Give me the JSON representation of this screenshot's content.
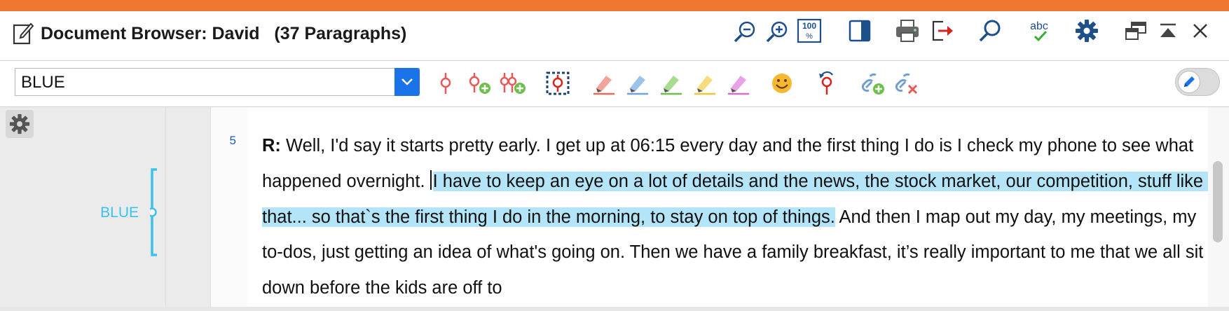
{
  "window": {
    "accent_color": "#f0782e",
    "title": "Document Browser: David   (37 Paragraphs)"
  },
  "title_icons": [
    {
      "name": "zoom-out-icon"
    },
    {
      "name": "zoom-in-icon"
    },
    {
      "name": "zoom-100-icon",
      "text": "100"
    },
    {
      "name": "panel-toggle-icon"
    },
    {
      "name": "print-icon"
    },
    {
      "name": "export-icon"
    },
    {
      "name": "search-icon"
    },
    {
      "name": "spellcheck-icon",
      "text": "abc"
    },
    {
      "name": "settings-gear-icon"
    },
    {
      "name": "undock-window-icon"
    },
    {
      "name": "collapse-icon"
    },
    {
      "name": "close-icon"
    }
  ],
  "toolbar": {
    "code_selector_value": "BLUE",
    "tools": [
      "code-icon",
      "code-new-icon",
      "code-multiple-icon",
      "select-area-icon",
      "highlighter-red-icon",
      "highlighter-blue-icon",
      "highlighter-green-icon",
      "highlighter-yellow-icon",
      "highlighter-purple-icon",
      "emoticon-icon",
      "undo-code-icon",
      "add-link-icon",
      "remove-link-icon"
    ],
    "edit_mode": false
  },
  "sidebar": {
    "code_label": "BLUE",
    "code_color": "#3cc1ef"
  },
  "document": {
    "paragraph_number": "5",
    "speaker": "R:",
    "text_before": " Well, I'd say it starts pretty early. I get up at 06:15 every day and the first thing I do is I check my phone to see what happened overnight. ",
    "highlighted_text": "I have to keep an eye on a lot of details and the news, the stock market, our competition, stuff like that... so that`s the first thing I do in the morning, to stay on top of things.",
    "text_after": " And then I map out my day, my meetings, my to-dos, just getting an idea of what's going on. Then we have a family breakfast, it’s really important to me that we all sit down before the kids are off to",
    "highlight_color": "#b3e4f7"
  }
}
